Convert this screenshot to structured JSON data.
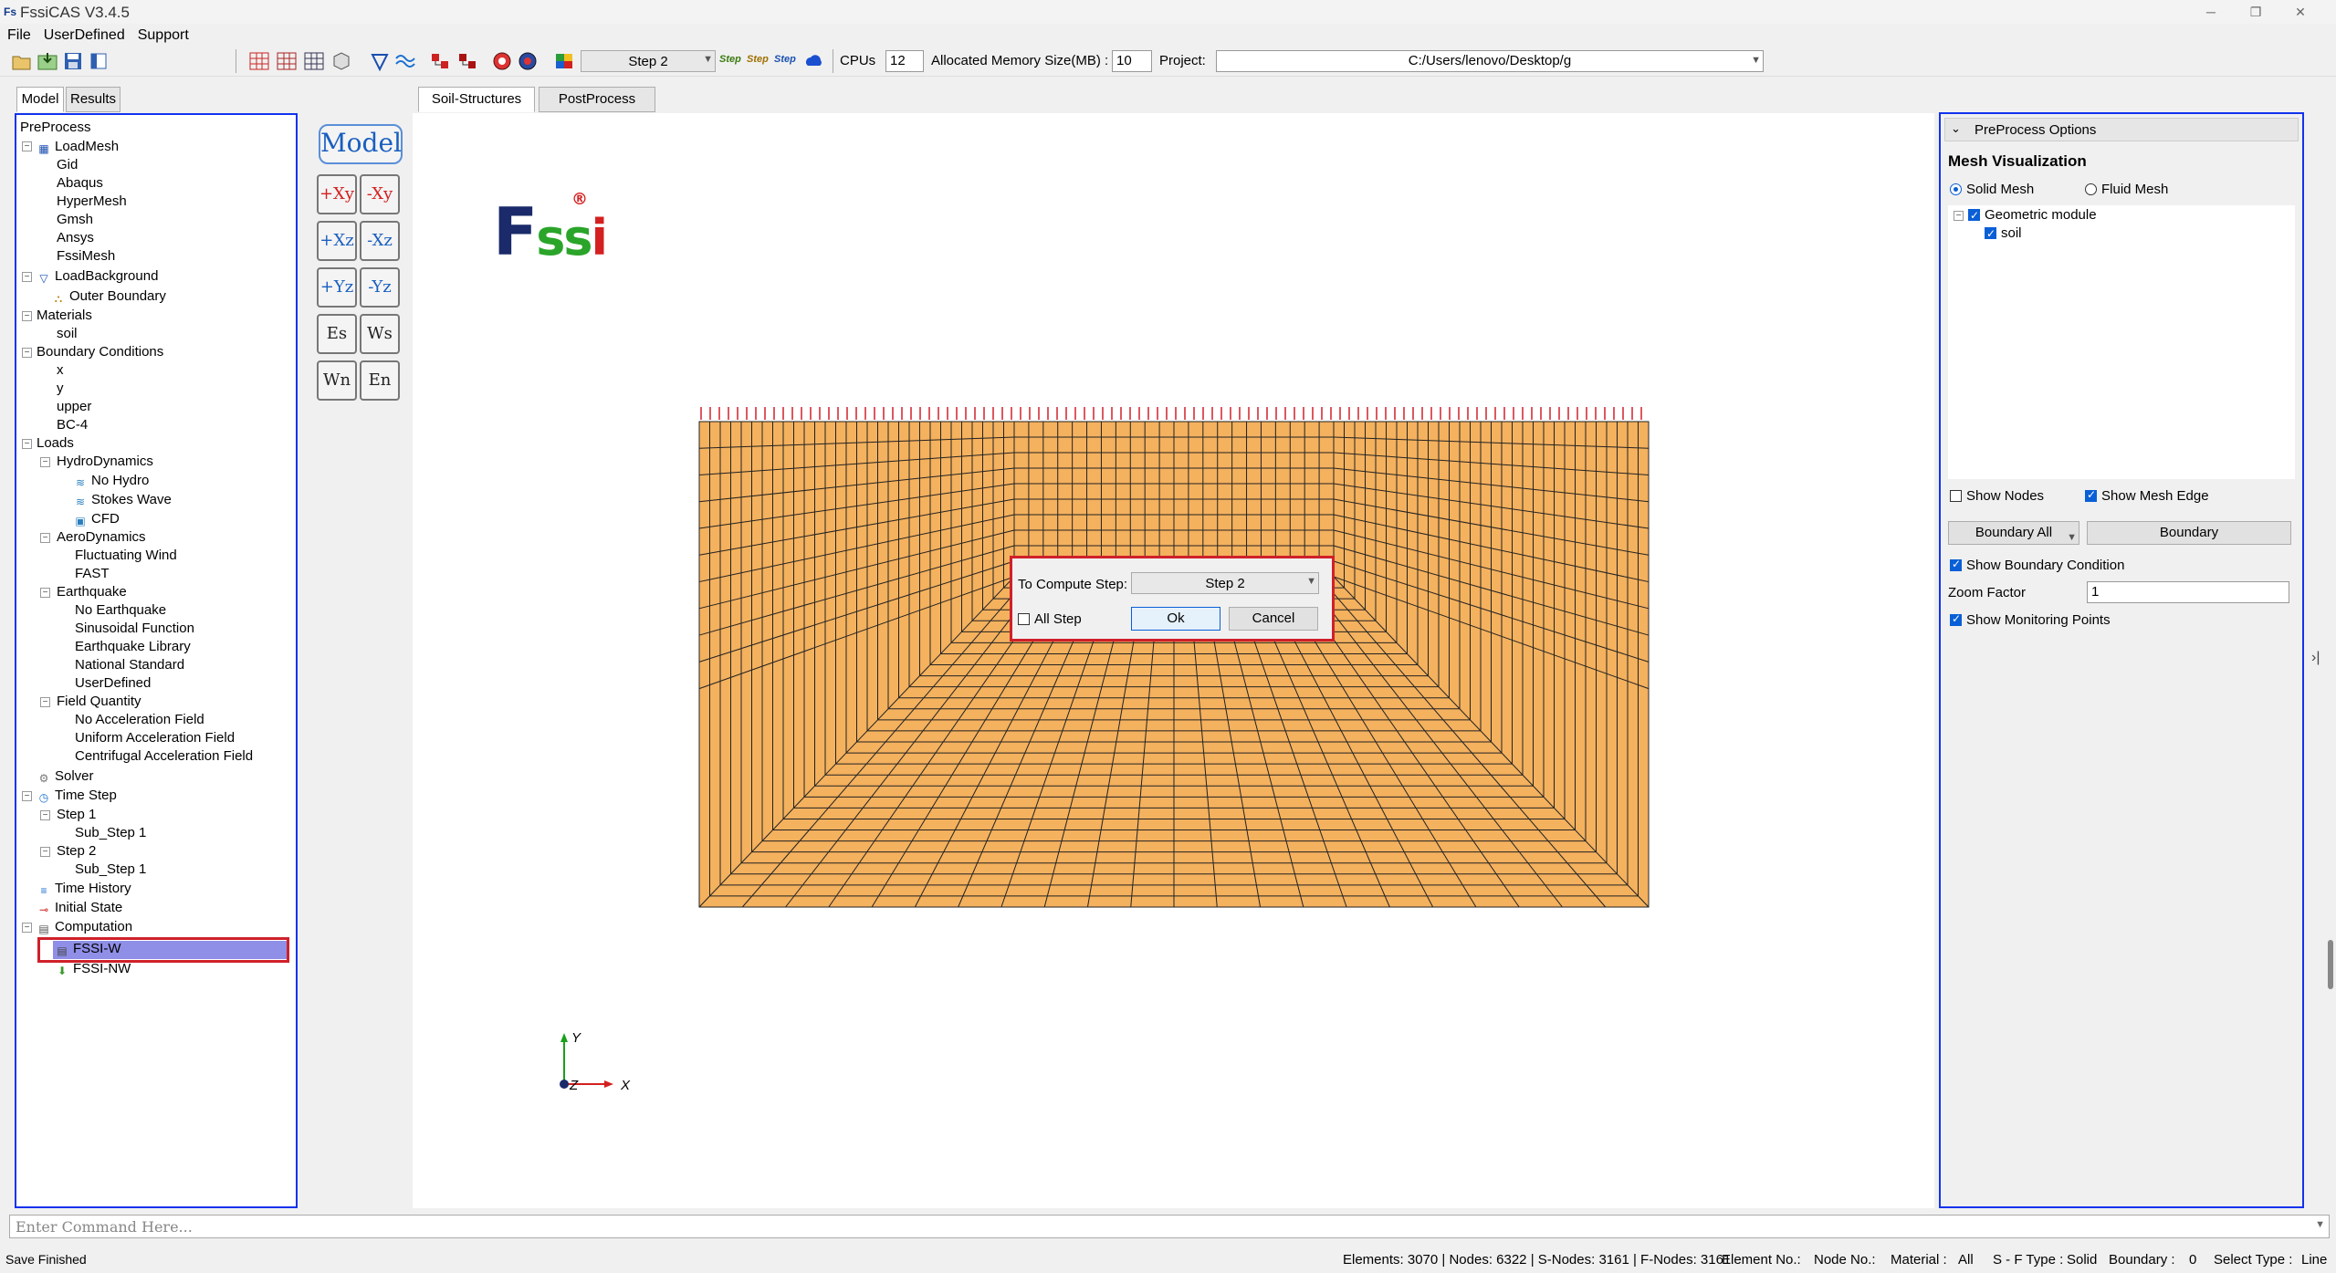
{
  "window": {
    "title": "FssiCAS V3.4.5",
    "app_icon": "Fs"
  },
  "menu": [
    "File",
    "UserDefined",
    "Support"
  ],
  "toolbar": {
    "step_select": "Step 2",
    "step_buttons": [
      "Step",
      "Step",
      "Step"
    ],
    "cpus_label": "CPUs",
    "cpus_value": "12",
    "memory_label": "Allocated Memory Size(MB) :",
    "memory_value": "10",
    "project_label": "Project:",
    "project_path": "C:/Users/lenovo/Desktop/g"
  },
  "left_tabs": [
    "Model",
    "Results"
  ],
  "center_tabs": [
    "Soil-Structures",
    "PostProcess"
  ],
  "tree": {
    "root": "PreProcess",
    "load_mesh": {
      "label": "LoadMesh",
      "children": [
        "Gid",
        "Abaqus",
        "HyperMesh",
        "Gmsh",
        "Ansys",
        "FssiMesh"
      ]
    },
    "load_background": {
      "label": "LoadBackground",
      "children": [
        "Outer Boundary"
      ]
    },
    "materials": {
      "label": "Materials",
      "children": [
        "soil"
      ]
    },
    "boundary_conditions": {
      "label": "Boundary Conditions",
      "children": [
        "x",
        "y",
        "upper",
        "BC-4"
      ]
    },
    "loads": {
      "label": "Loads",
      "hydro": {
        "label": "HydroDynamics",
        "children": [
          "No Hydro",
          "Stokes Wave",
          "CFD"
        ]
      },
      "aero": {
        "label": "AeroDynamics",
        "children": [
          "Fluctuating Wind",
          "FAST"
        ]
      },
      "earthquake": {
        "label": "Earthquake",
        "children": [
          "No Earthquake",
          "Sinusoidal Function",
          "Earthquake Library",
          "National Standard",
          "UserDefined"
        ]
      },
      "field": {
        "label": "Field Quantity",
        "children": [
          "No Acceleration Field",
          "Uniform Acceleration Field",
          "Centrifugal Acceleration Field"
        ]
      }
    },
    "solver": "Solver",
    "time_step": {
      "label": "Time Step",
      "step1": "Step 1",
      "step1_sub": "Sub_Step 1",
      "step2": "Step 2",
      "step2_sub": "Sub_Step 1"
    },
    "time_history": "Time History",
    "initial_state": "Initial State",
    "computation": {
      "label": "Computation",
      "children": [
        "FSSI-W",
        "FSSI-NW"
      ]
    }
  },
  "view_buttons": [
    "Model",
    "+Xy",
    "-Xy",
    "+Xz",
    "-Xz",
    "+Yz",
    "-Yz",
    "Es",
    "Ws",
    "Wn",
    "En"
  ],
  "logo": {
    "text_f": "F",
    "text_ss": "ss",
    "text_i": "i",
    "reg": "®"
  },
  "axes": {
    "y": "Y",
    "z": "Z",
    "x": "X"
  },
  "dialog": {
    "label": "To Compute Step:",
    "step_value": "Step 2",
    "all_step_label": "All Step",
    "ok_label": "Ok",
    "cancel_label": "Cancel"
  },
  "right_panel": {
    "header": "PreProcess Options",
    "section_title": "Mesh Visualization",
    "solid_mesh": "Solid Mesh",
    "fluid_mesh": "Fluid Mesh",
    "geometric_module": "Geometric module",
    "soil": "soil",
    "show_nodes": "Show Nodes",
    "show_mesh_edge": "Show Mesh Edge",
    "boundary_all": "Boundary All",
    "boundary_btn": "Boundary",
    "show_boundary_condition": "Show Boundary Condition",
    "zoom_label": "Zoom Factor",
    "zoom_value": "1",
    "show_monitoring": "Show Monitoring Points"
  },
  "command": {
    "placeholder": "Enter Command Here..."
  },
  "status": {
    "left": "Save Finished",
    "elements": "Elements: 3070 | Nodes: 6322 | S-Nodes: 3161 | F-Nodes: 3161",
    "element_no": "Element No.:",
    "node_no": "Node No.:",
    "material": "Material :",
    "material_value": "All",
    "sf_type": "S - F Type :",
    "sf_value": "Solid",
    "boundary": "Boundary :",
    "boundary_value": "0",
    "select_type": "Select Type :",
    "select_value": "Line"
  },
  "colors": {
    "mesh_fill": "#f4b15e",
    "highlight": "#d0202a",
    "panel_border": "#1133ee",
    "accent": "#0a5fd6"
  }
}
